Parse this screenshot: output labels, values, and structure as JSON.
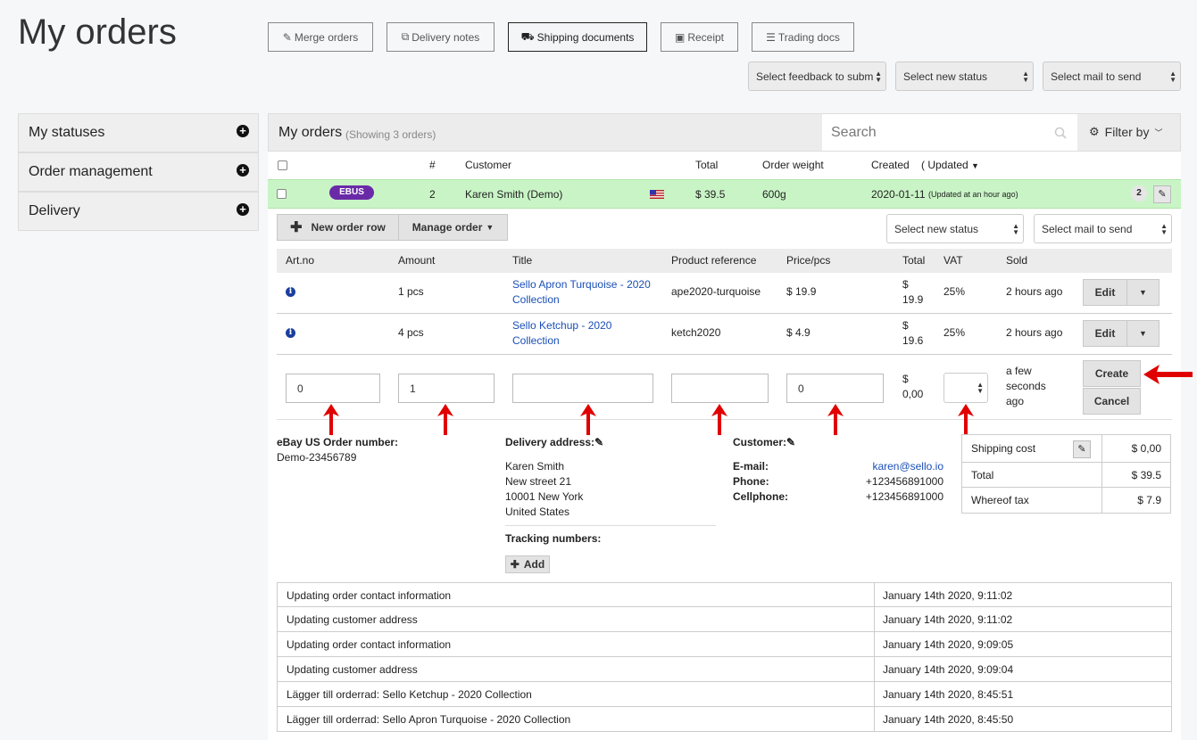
{
  "page_title": "My orders",
  "toolbar": {
    "merge": "Merge orders",
    "delivery_notes": "Delivery notes",
    "shipping_documents": "Shipping documents",
    "receipt": "Receipt",
    "trading_docs": "Trading docs"
  },
  "top_selects": {
    "feedback": "Select feedback to subm",
    "status": "Select new status",
    "mail": "Select mail to send"
  },
  "sidebar": {
    "items": [
      {
        "label": "My statuses"
      },
      {
        "label": "Order management"
      },
      {
        "label": "Delivery"
      }
    ]
  },
  "list": {
    "title": "My orders",
    "showing": "(Showing 3 orders)",
    "search_placeholder": "Search",
    "filter_label": "Filter by",
    "columns": {
      "num": "#",
      "customer": "Customer",
      "total": "Total",
      "weight": "Order weight",
      "created": "Created",
      "updated": "( Updated"
    }
  },
  "order": {
    "badge": "EBUS",
    "number": "2",
    "customer": "Karen Smith (Demo)",
    "total": "$ 39.5",
    "weight": "600g",
    "created": "2020-01-11",
    "updated_note": "(Updated at an hour ago)",
    "count": "2"
  },
  "detail": {
    "new_row": "New order row",
    "manage_order": "Manage order",
    "status_select": "Select new status",
    "mail_select": "Select mail to send",
    "columns": {
      "artno": "Art.no",
      "amount": "Amount",
      "title": "Title",
      "ref": "Product reference",
      "price": "Price/pcs",
      "total": "Total",
      "vat": "VAT",
      "sold": "Sold"
    },
    "rows": [
      {
        "amount": "1 pcs",
        "title_1": "Sello Apron Turquoise - 2020",
        "title_2": "Collection",
        "ref": "ape2020-turquoise",
        "price": "$ 19.9",
        "total_1": "$",
        "total_2": "19.9",
        "vat": "25%",
        "sold": "2 hours ago",
        "edit": "Edit"
      },
      {
        "amount": "4 pcs",
        "title_1": "Sello Ketchup - 2020",
        "title_2": "Collection",
        "ref": "ketch2020",
        "price": "$ 4.9",
        "total_1": "$",
        "total_2": "19.6",
        "vat": "25%",
        "sold": "2 hours ago",
        "edit": "Edit"
      }
    ],
    "new_row_form": {
      "artno": "0",
      "amount": "1",
      "title": "",
      "ref": "",
      "price": "0",
      "total_1": "$",
      "total_2": "0,00",
      "sold_1": "a few",
      "sold_2": "seconds",
      "sold_3": "ago",
      "create": "Create",
      "cancel": "Cancel"
    }
  },
  "info": {
    "ebay_label": "eBay US Order number:",
    "ebay_value": "Demo-23456789",
    "delivery_label": "Delivery address:",
    "address": [
      "Karen Smith",
      "New street 21",
      "10001 New York",
      "United States"
    ],
    "tracking_label": "Tracking numbers:",
    "add_label": "Add",
    "customer_label": "Customer:",
    "email_label": "E-mail:",
    "email_value": "karen@sello.io",
    "phone_label": "Phone:",
    "phone_value": "+123456891000",
    "cell_label": "Cellphone:",
    "cell_value": "+123456891000"
  },
  "summary": {
    "shipping_label": "Shipping cost",
    "shipping_value": "$ 0,00",
    "total_label": "Total",
    "total_value": "$ 39.5",
    "tax_label": "Whereof tax",
    "tax_value": "$ 7.9"
  },
  "log": [
    {
      "text": "Updating order contact information",
      "time": "January 14th 2020, 9:11:02"
    },
    {
      "text": "Updating customer address",
      "time": "January 14th 2020, 9:11:02"
    },
    {
      "text": "Updating order contact information",
      "time": "January 14th 2020, 9:09:05"
    },
    {
      "text": "Updating customer address",
      "time": "January 14th 2020, 9:09:04"
    },
    {
      "text": "Lägger till orderrad: Sello Ketchup - 2020 Collection",
      "time": "January 14th 2020, 8:45:51"
    },
    {
      "text": "Lägger till orderrad: Sello Apron Turquoise - 2020 Collection",
      "time": "January 14th 2020, 8:45:50"
    }
  ],
  "colors": {
    "order_row_bg": "#c9f5c6",
    "badge": "#6a2aa8",
    "link": "#1a4fb7",
    "annotation_arrow": "#e00000"
  }
}
